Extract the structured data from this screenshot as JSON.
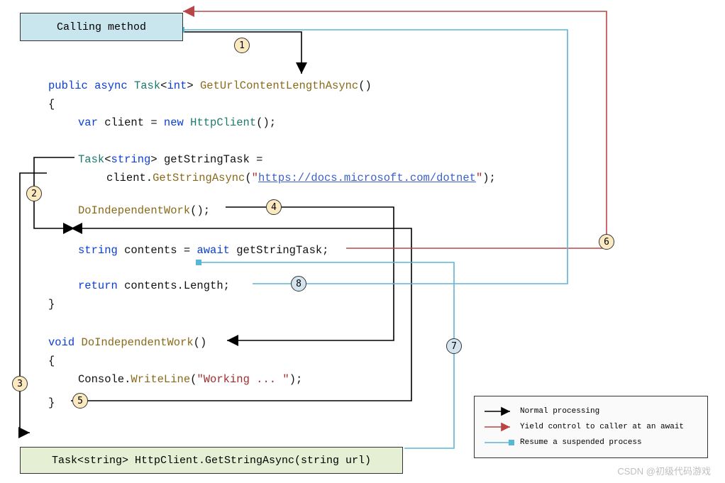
{
  "boxes": {
    "calling": "Calling method",
    "bottom": "Task<string> HttpClient.GetStringAsync(string url)"
  },
  "legend": {
    "normal": "Normal processing",
    "yield": "Yield control to caller at an await",
    "resume": "Resume a suspended process"
  },
  "steps": {
    "s1": "1",
    "s2": "2",
    "s3": "3",
    "s4": "4",
    "s5": "5",
    "s6": "6",
    "s7": "7",
    "s8": "8"
  },
  "code": {
    "l1a": "public",
    "l1b": "async",
    "l1c": "Task",
    "l1d": "int",
    "l1e": "GetUrlContentLengthAsync",
    "l1f": "()",
    "l2": "{",
    "l3a": "var",
    "l3b": " client = ",
    "l3c": "new",
    "l3d": " ",
    "l3e": "HttpClient",
    "l3f": "();",
    "l4a": "Task",
    "l4b": "string",
    "l4c": "> getStringTask =",
    "l5a": "client.",
    "l5b": "GetStringAsync",
    "l5c": "(",
    "l5d": "\"",
    "l5e": "https://docs.microsoft.com/dotnet",
    "l5f": "\"",
    "l5g": ");",
    "l6a": "DoIndependentWork",
    "l6b": "();",
    "l7a": "string",
    "l7b": " contents = ",
    "l7c": "await",
    "l7d": " getStringTask;",
    "l8a": "return",
    "l8b": " contents.Length;",
    "l9": "}",
    "l10a": "void",
    "l10b": " ",
    "l10c": "DoIndependentWork",
    "l10d": "()",
    "l11": "{",
    "l12a": "Console.",
    "l12b": "WriteLine",
    "l12c": "(",
    "l12d": "\"Working ... \"",
    "l12e": ");",
    "l13": "}"
  },
  "watermark": "CSDN @初级代码游戏"
}
